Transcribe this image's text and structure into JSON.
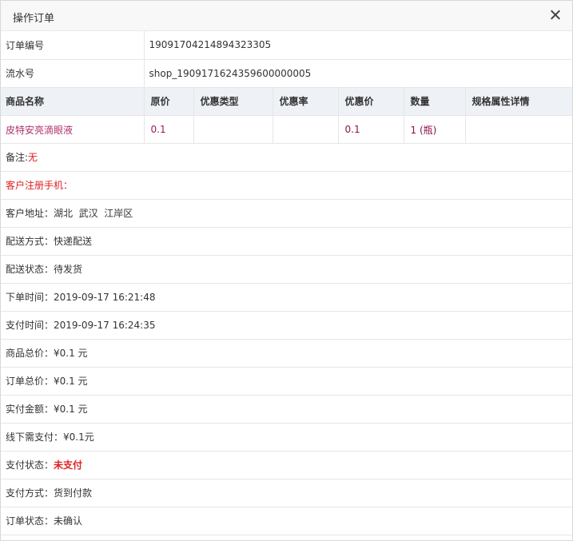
{
  "dialog": {
    "title": "操作订单"
  },
  "order": {
    "number_label": "订单编号",
    "number_value": "19091704214894323305",
    "serial_label": "流水号",
    "serial_value": "shop_1909171624359600000005"
  },
  "goods": {
    "headers": [
      "商品名称",
      "原价",
      "优惠类型",
      "优惠率",
      "优惠价",
      "数量",
      "规格属性详情"
    ],
    "rows": [
      {
        "name": "皮特安亮滴眼液",
        "price": "0.1",
        "discount_type": "",
        "discount_rate": "",
        "discount_price": "0.1",
        "quantity": "1",
        "unit": "(瓶)",
        "spec": ""
      }
    ]
  },
  "details": {
    "remark_label": "备注:",
    "remark_value": "无",
    "phone_label": "客户注册手机：",
    "address_label": "客户地址：",
    "address_value": "湖北  武汉  江岸区",
    "delivery_method_label": "配送方式：",
    "delivery_method_value": "快递配送",
    "delivery_status_label": "配送状态：",
    "delivery_status_value": "待发货",
    "order_time_label": "下单时间：",
    "order_time_value": "2019-09-17 16:21:48",
    "pay_time_label": "支付时间：",
    "pay_time_value": "2019-09-17 16:24:35",
    "goods_total_label": "商品总价：",
    "goods_total_value": "¥0.1 元",
    "order_total_label": "订单总价：",
    "order_total_value": "¥0.1 元",
    "actual_amount_label": "实付金额：",
    "actual_amount_value": "¥0.1 元",
    "offline_pay_label": "线下需支付：",
    "offline_pay_value": "¥0.1元",
    "pay_status_label": "支付状态：",
    "pay_status_value": "未支付",
    "pay_method_label": "支付方式：",
    "pay_method_value": "货到付款",
    "order_status_label": "订单状态：",
    "order_status_value": "未确认"
  }
}
